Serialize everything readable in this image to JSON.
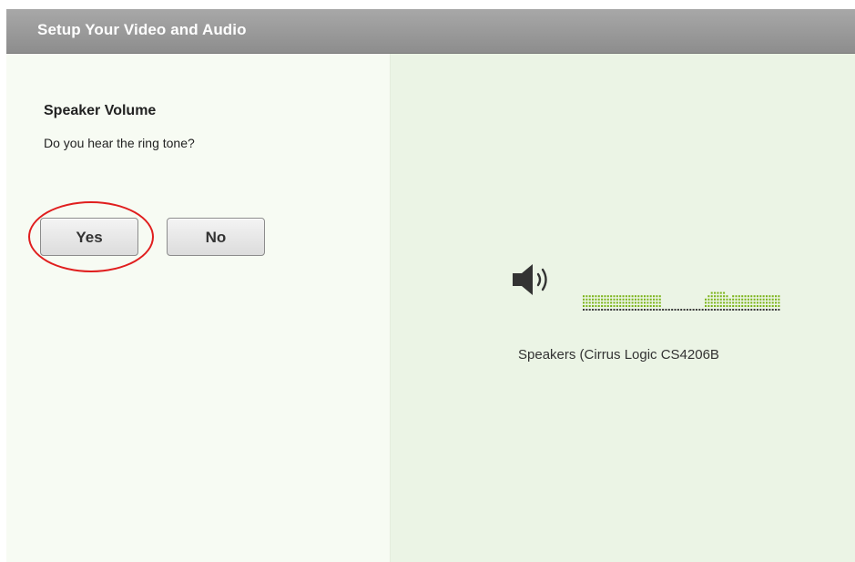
{
  "dialog": {
    "title": "Setup Your Video and Audio"
  },
  "left": {
    "section_title": "Speaker Volume",
    "question": "Do you hear the ring tone?",
    "yes_label": "Yes",
    "no_label": "No",
    "highlight_color": "#e01e1e"
  },
  "right": {
    "speaker_icon": "speaker-volume-icon",
    "device_name": "Speakers (Cirrus Logic CS4206B",
    "meter_colors": {
      "active": "#7ab317",
      "inactive": "#3a3a3a"
    }
  }
}
